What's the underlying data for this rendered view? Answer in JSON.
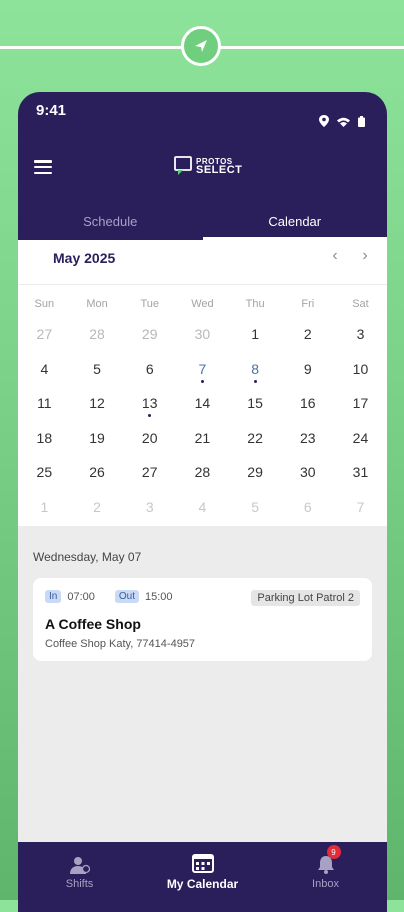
{
  "status": {
    "time": "9:41"
  },
  "header": {
    "logo_line1": "PROTOS",
    "logo_line2": "SELECT"
  },
  "tabs": [
    {
      "label": "Schedule",
      "active": false
    },
    {
      "label": "Calendar",
      "active": true
    }
  ],
  "calendar": {
    "month_title": "May 2025",
    "weekdays": [
      "Sun",
      "Mon",
      "Tue",
      "Wed",
      "Thu",
      "Fri",
      "Sat"
    ],
    "weeks": [
      [
        "27",
        "28",
        "29",
        "30",
        "1",
        "2",
        "3"
      ],
      [
        "4",
        "5",
        "6",
        "7",
        "8",
        "9",
        "10"
      ],
      [
        "11",
        "12",
        "13",
        "14",
        "15",
        "16",
        "17"
      ],
      [
        "18",
        "19",
        "20",
        "21",
        "22",
        "23",
        "24"
      ],
      [
        "25",
        "26",
        "27",
        "28",
        "29",
        "30",
        "31"
      ],
      [
        "1",
        "2",
        "3",
        "4",
        "5",
        "6",
        "7"
      ]
    ]
  },
  "agenda": {
    "date_label": "Wednesday, May 07",
    "shift": {
      "in_label": "In",
      "in_time": "07:00",
      "out_label": "Out",
      "out_time": "15:00",
      "post": "Parking Lot Patrol 2",
      "site_name": "A Coffee Shop",
      "address": "Coffee Shop Katy, 77414-4957"
    }
  },
  "bottom_nav": [
    {
      "label": "Shifts",
      "icon": "shifts-icon"
    },
    {
      "label": "My Calendar",
      "icon": "calendar-icon",
      "active": true
    },
    {
      "label": "Inbox",
      "icon": "bell-icon",
      "badge": "9"
    }
  ],
  "colors": {
    "brand_dark": "#2a1f5b",
    "background_green": "#7fd58b",
    "badge_red": "#e22c3a",
    "tag_blue": "#c9daf6"
  }
}
